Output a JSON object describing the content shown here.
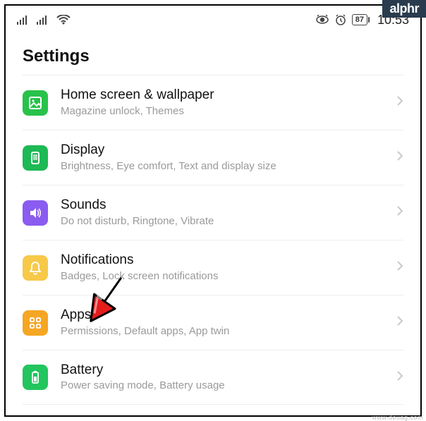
{
  "badge": "alphr",
  "watermark": "www.deuag.com",
  "statusbar": {
    "battery": "87",
    "time": "10:53"
  },
  "page": {
    "title": "Settings"
  },
  "rows": [
    {
      "id": "home-screen",
      "icon": "wallpaper-icon",
      "color": "c-green",
      "title": "Home screen & wallpaper",
      "subtitle": "Magazine unlock, Themes"
    },
    {
      "id": "display",
      "icon": "display-icon",
      "color": "c-green2",
      "title": "Display",
      "subtitle": "Brightness, Eye comfort, Text and display size"
    },
    {
      "id": "sounds",
      "icon": "sounds-icon",
      "color": "c-purple",
      "title": "Sounds",
      "subtitle": "Do not disturb, Ringtone, Vibrate"
    },
    {
      "id": "notifications",
      "icon": "bell-icon",
      "color": "c-yellow",
      "title": "Notifications",
      "subtitle": "Badges, Lock screen notifications"
    },
    {
      "id": "apps",
      "icon": "apps-icon",
      "color": "c-orange",
      "title": "Apps",
      "subtitle": "Permissions, Default apps, App twin"
    },
    {
      "id": "battery",
      "icon": "battery-icon",
      "color": "c-green3",
      "title": "Battery",
      "subtitle": "Power saving mode, Battery usage"
    }
  ]
}
